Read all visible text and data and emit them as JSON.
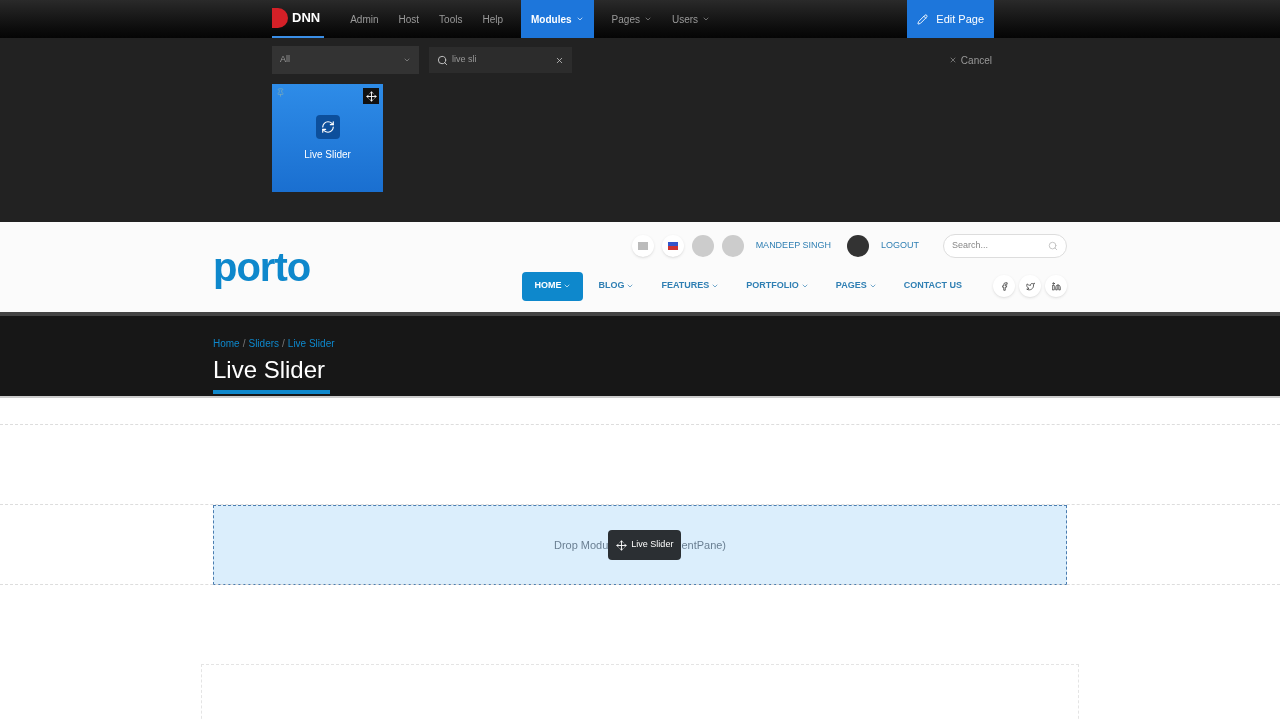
{
  "admin_bar": {
    "logo": "DNN",
    "menu": [
      {
        "label": "Admin",
        "selected": false,
        "dropdown": false
      },
      {
        "label": "Host",
        "selected": false,
        "dropdown": false
      },
      {
        "label": "Tools",
        "selected": false,
        "dropdown": false
      },
      {
        "label": "Help",
        "selected": false,
        "dropdown": false
      },
      {
        "label": "Modules",
        "selected": true,
        "dropdown": true
      },
      {
        "label": "Pages",
        "selected": false,
        "dropdown": true
      },
      {
        "label": "Users",
        "selected": false,
        "dropdown": true
      }
    ],
    "edit_button": "Edit Page"
  },
  "module_panel": {
    "category": "All",
    "search": "live sli",
    "cancel": "Cancel",
    "modules": [
      {
        "name": "Live Slider"
      }
    ]
  },
  "site_header": {
    "logo": "porto",
    "user": "MANDEEP SINGH",
    "logout": "LOGOUT",
    "search": {
      "placeholder": "Search..."
    },
    "nav": [
      {
        "label": "HOME",
        "selected": true,
        "dropdown": true
      },
      {
        "label": "BLOG",
        "selected": false,
        "dropdown": true
      },
      {
        "label": "FEATURES",
        "selected": false,
        "dropdown": true
      },
      {
        "label": "PORTFOLIO",
        "selected": false,
        "dropdown": true
      },
      {
        "label": "PAGES",
        "selected": false,
        "dropdown": true
      },
      {
        "label": "CONTACT US",
        "selected": false,
        "dropdown": false
      }
    ]
  },
  "page_title": {
    "breadcrumb": [
      {
        "kind": "link",
        "label": "Home"
      },
      {
        "kind": "separator",
        "label": "/"
      },
      {
        "kind": "link",
        "label": "Sliders"
      },
      {
        "kind": "separator",
        "label": "/"
      },
      {
        "kind": "link",
        "label": "Live Slider"
      }
    ],
    "title": "Live Slider"
  },
  "drop_zone": {
    "text_before": "Drop Modu",
    "text_after": "entPane)",
    "dragged_module": "Live Slider"
  }
}
